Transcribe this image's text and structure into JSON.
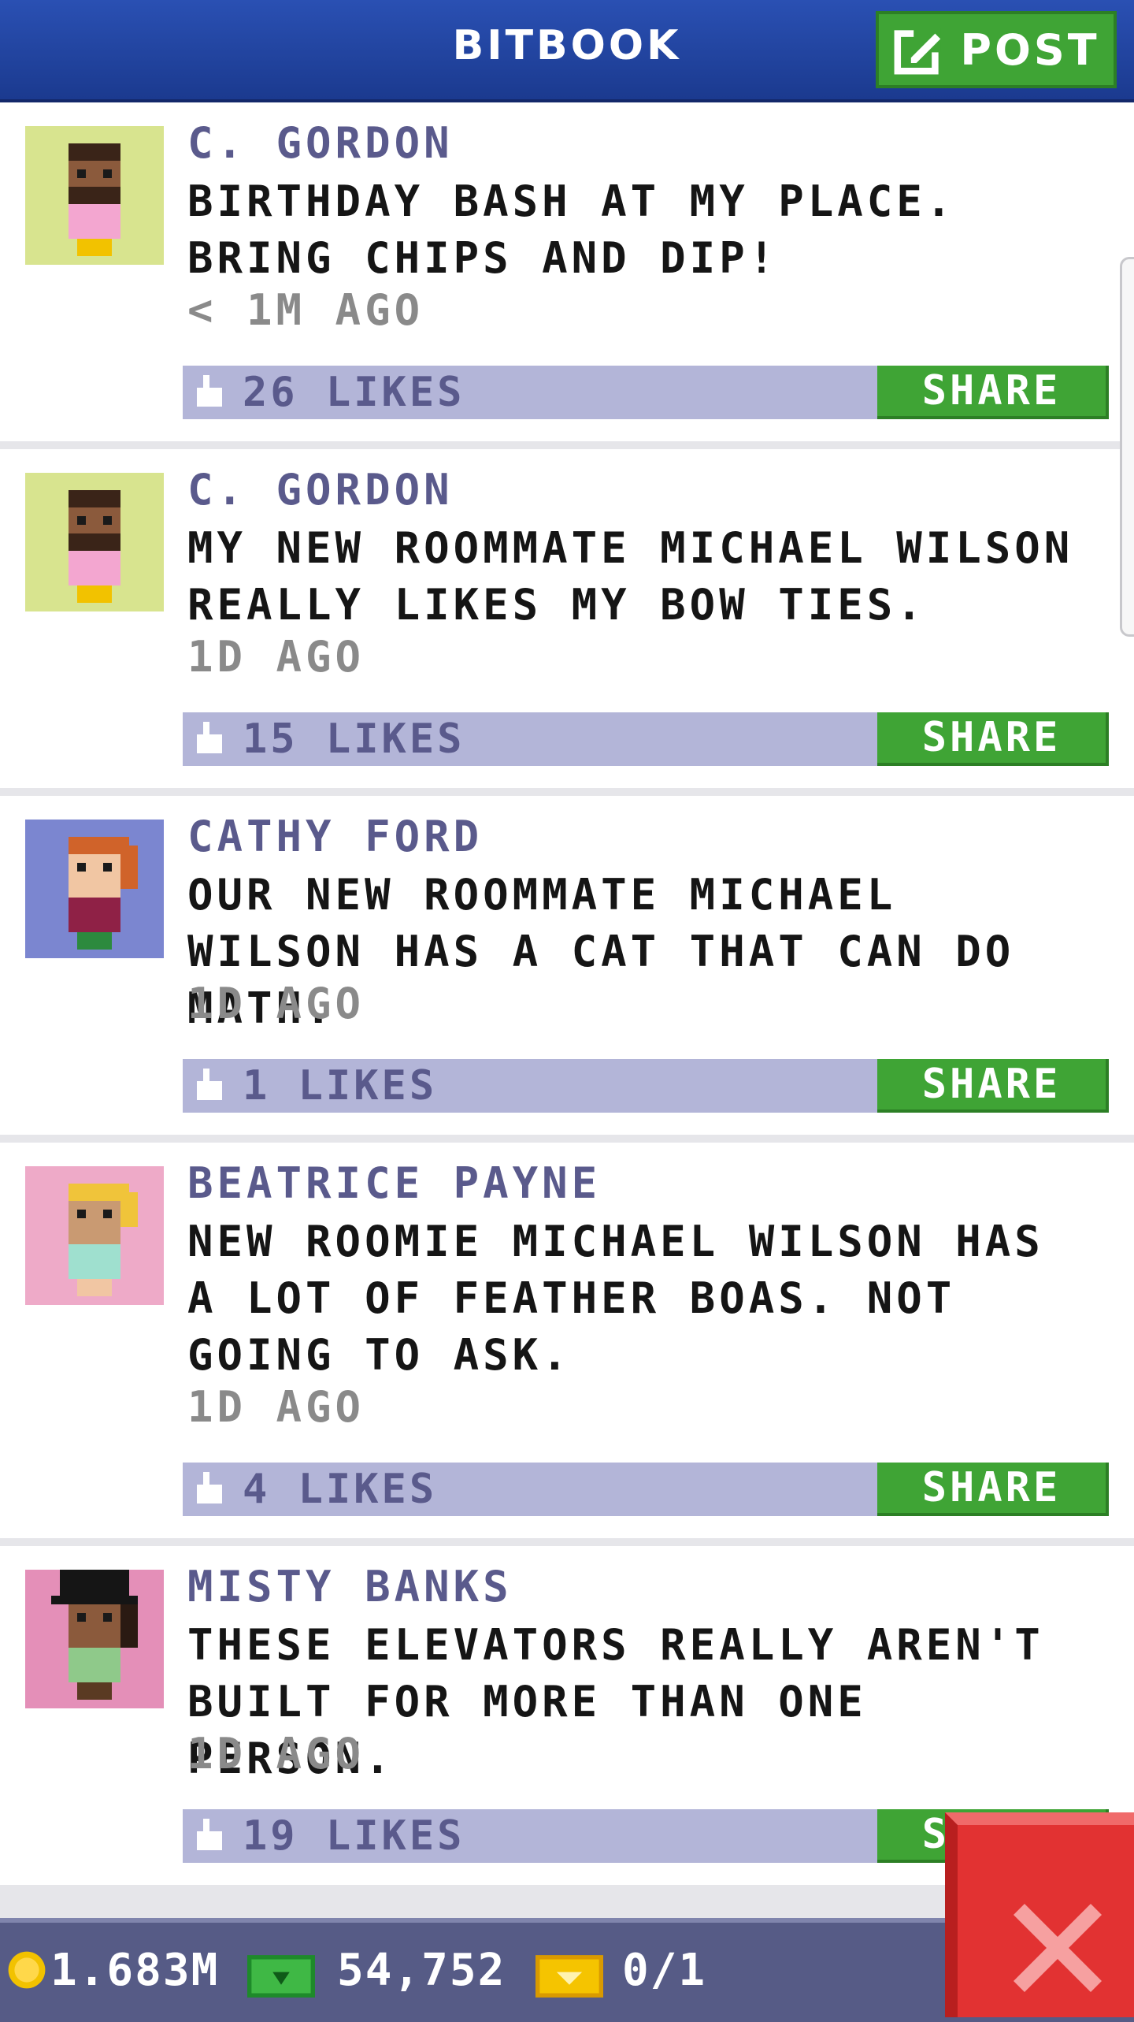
{
  "header": {
    "title": "BITBOOK",
    "post_label": "POST"
  },
  "posts": [
    {
      "author": "C. GORDON",
      "text": "BIRTHDAY BASH AT MY PLACE. BRING CHIPS AND DIP!",
      "time": "< 1M AGO",
      "likes": "26 LIKES",
      "share": "SHARE",
      "avatar_bg": "#d8e48f"
    },
    {
      "author": "C. GORDON",
      "text": "MY NEW ROOMMATE MICHAEL WILSON REALLY LIKES MY BOW TIES.",
      "time": "1D AGO",
      "likes": "15 LIKES",
      "share": "SHARE",
      "avatar_bg": "#d8e48f"
    },
    {
      "author": "CATHY FORD",
      "text": "OUR NEW ROOMMATE MICHAEL WILSON HAS A CAT THAT CAN DO MATH.",
      "time": "1D AGO",
      "likes": "1 LIKES",
      "share": "SHARE",
      "avatar_bg": "#7b86d0"
    },
    {
      "author": "BEATRICE PAYNE",
      "text": "NEW ROOMIE MICHAEL WILSON HAS A LOT OF FEATHER BOAS. NOT GOING TO ASK.",
      "time": "1D AGO",
      "likes": "4 LIKES",
      "share": "SHARE",
      "avatar_bg": "#eeaac8"
    },
    {
      "author": "MISTY BANKS",
      "text": "THESE ELEVATORS REALLY AREN'T BUILT FOR MORE THAN ONE PERSON.",
      "time": "1D AGO",
      "likes": "19 LIKES",
      "share": "SHARE",
      "avatar_bg": "#e48fb8"
    }
  ],
  "bottom_bar": {
    "coins": "1.683M",
    "bux": "54,752",
    "tickets": "0/1"
  },
  "colors": {
    "header": "#2a50b3",
    "green": "#3fa435",
    "like_bar": "#b3b5d8",
    "close": "#e23232"
  }
}
